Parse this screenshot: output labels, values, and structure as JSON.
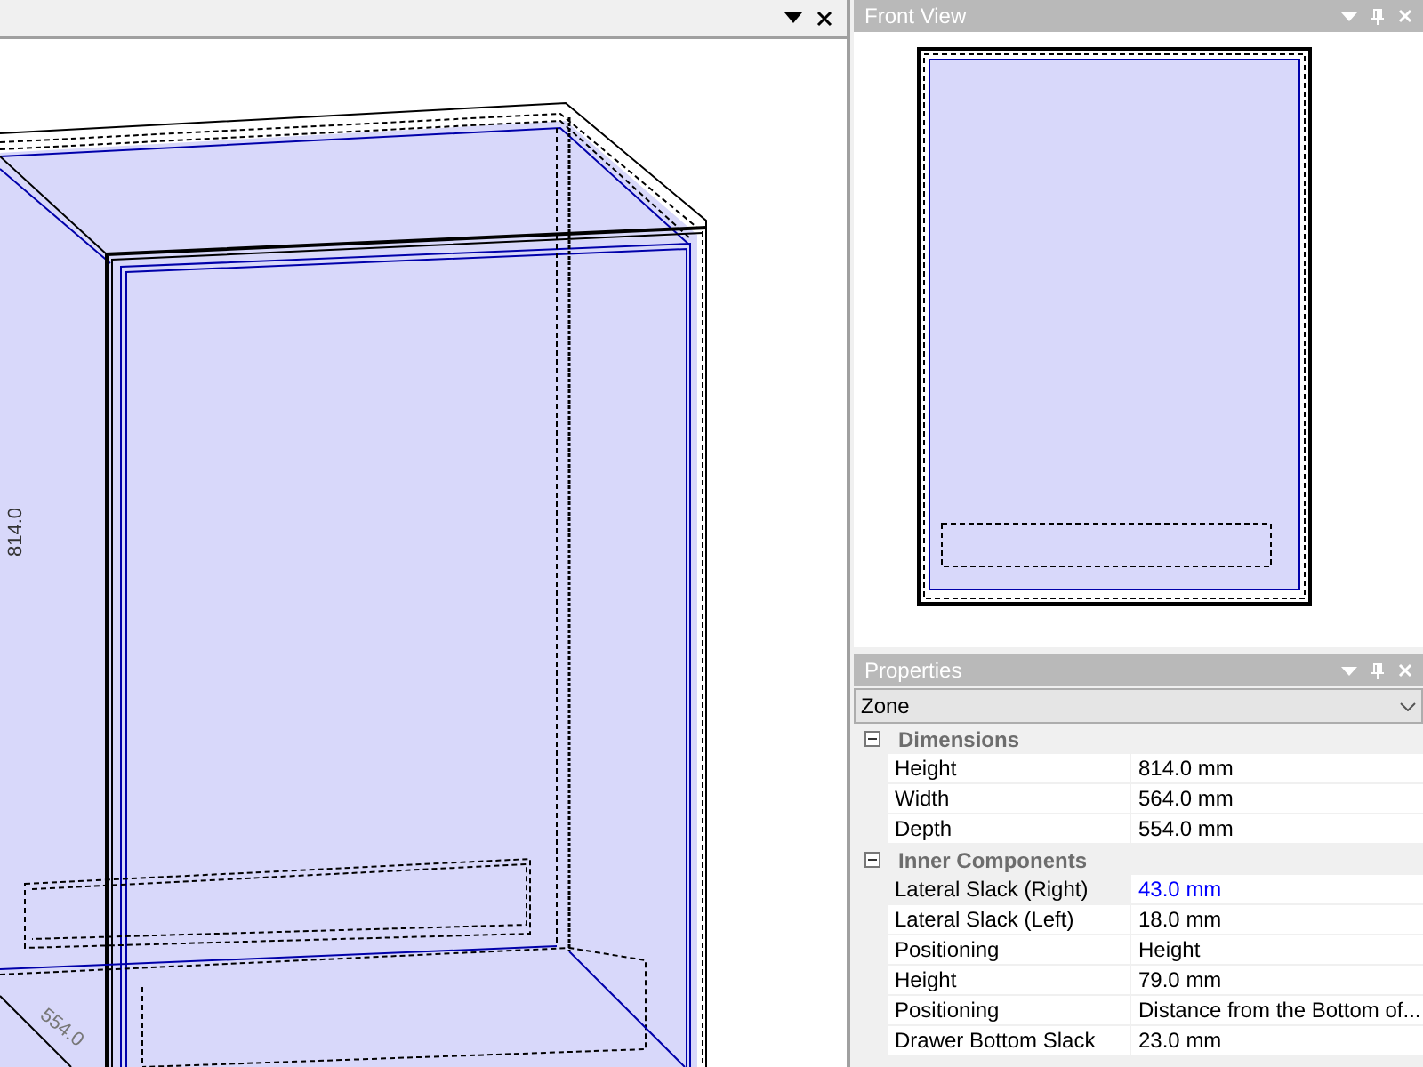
{
  "viewport": {
    "dimension_labels": [
      {
        "text": "814.0",
        "kind": "vertical"
      },
      {
        "text": "554.0",
        "kind": "diagonal"
      }
    ]
  },
  "front_view": {
    "title": "Front View"
  },
  "properties": {
    "title": "Properties",
    "object_selector": "Zone",
    "categories": [
      {
        "name": "Dimensions",
        "expanded": true,
        "rows": [
          {
            "name": "Height",
            "value": "814.0 mm",
            "selected": false,
            "modified": false
          },
          {
            "name": "Width",
            "value": "564.0 mm",
            "selected": false,
            "modified": false
          },
          {
            "name": "Depth",
            "value": "554.0 mm",
            "selected": false,
            "modified": false
          }
        ]
      },
      {
        "name": "Inner Components",
        "expanded": true,
        "rows": [
          {
            "name": "Lateral Slack (Right)",
            "value": "43.0 mm",
            "selected": true,
            "modified": true
          },
          {
            "name": "Lateral Slack (Left)",
            "value": "18.0 mm",
            "selected": false,
            "modified": false
          },
          {
            "name": "Positioning",
            "value": "Height",
            "selected": false,
            "modified": false
          },
          {
            "name": "Height",
            "value": "79.0 mm",
            "selected": false,
            "modified": false
          },
          {
            "name": "Positioning",
            "value": "Distance from the Bottom of...",
            "selected": false,
            "modified": false
          },
          {
            "name": "Drawer Bottom Slack",
            "value": "23.0 mm",
            "selected": false,
            "modified": false
          }
        ]
      }
    ]
  }
}
